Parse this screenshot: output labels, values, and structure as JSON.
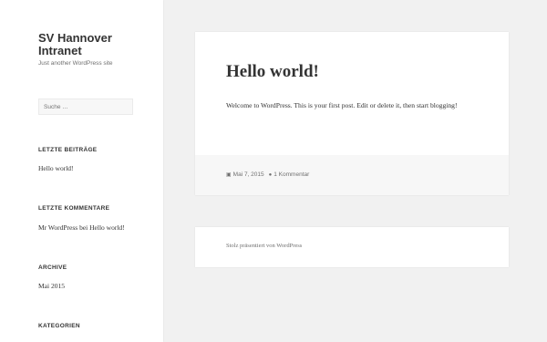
{
  "site": {
    "title": "SV Hannover Intranet",
    "description": "Just another WordPress site"
  },
  "search": {
    "placeholder": "Suche …"
  },
  "widgets": {
    "recent_posts": {
      "title": "LETZTE BEITRÄGE",
      "items": [
        "Hello world!"
      ]
    },
    "recent_comments": {
      "title": "LETZTE KOMMENTARE",
      "author": "Mr WordPress",
      "connector": "bei",
      "post": "Hello world!"
    },
    "archives": {
      "title": "ARCHIVE",
      "items": [
        "Mai 2015"
      ]
    },
    "categories": {
      "title": "KATEGORIEN"
    }
  },
  "post": {
    "title": "Hello world!",
    "content": "Welcome to WordPress. This is your first post. Edit or delete it, then start blogging!",
    "date": "Mai 7, 2015",
    "comments": "1 Kommentar",
    "date_icon": "calendar-icon",
    "comment_icon": "comment-icon"
  },
  "footer": {
    "text": "Stolz präsentiert von WordPress"
  },
  "colors": {
    "background": "#f1f1f1",
    "panel": "#ffffff",
    "text": "#333333",
    "muted": "#707070"
  }
}
